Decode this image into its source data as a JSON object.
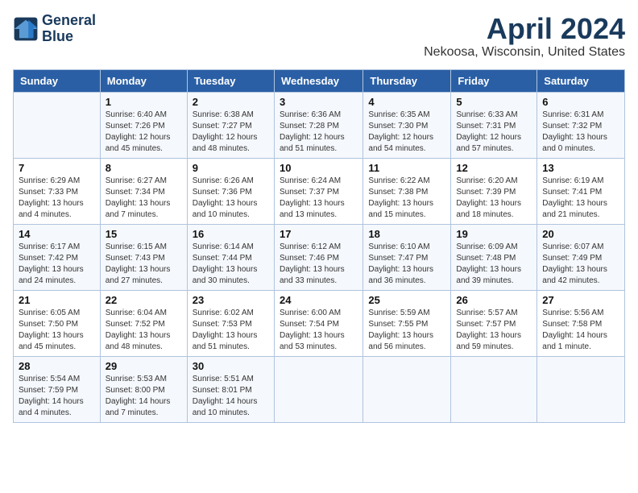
{
  "header": {
    "logo_line1": "General",
    "logo_line2": "Blue",
    "month": "April 2024",
    "location": "Nekoosa, Wisconsin, United States"
  },
  "days_of_week": [
    "Sunday",
    "Monday",
    "Tuesday",
    "Wednesday",
    "Thursday",
    "Friday",
    "Saturday"
  ],
  "weeks": [
    [
      {
        "day": "",
        "info": ""
      },
      {
        "day": "1",
        "info": "Sunrise: 6:40 AM\nSunset: 7:26 PM\nDaylight: 12 hours\nand 45 minutes."
      },
      {
        "day": "2",
        "info": "Sunrise: 6:38 AM\nSunset: 7:27 PM\nDaylight: 12 hours\nand 48 minutes."
      },
      {
        "day": "3",
        "info": "Sunrise: 6:36 AM\nSunset: 7:28 PM\nDaylight: 12 hours\nand 51 minutes."
      },
      {
        "day": "4",
        "info": "Sunrise: 6:35 AM\nSunset: 7:30 PM\nDaylight: 12 hours\nand 54 minutes."
      },
      {
        "day": "5",
        "info": "Sunrise: 6:33 AM\nSunset: 7:31 PM\nDaylight: 12 hours\nand 57 minutes."
      },
      {
        "day": "6",
        "info": "Sunrise: 6:31 AM\nSunset: 7:32 PM\nDaylight: 13 hours\nand 0 minutes."
      }
    ],
    [
      {
        "day": "7",
        "info": "Sunrise: 6:29 AM\nSunset: 7:33 PM\nDaylight: 13 hours\nand 4 minutes."
      },
      {
        "day": "8",
        "info": "Sunrise: 6:27 AM\nSunset: 7:34 PM\nDaylight: 13 hours\nand 7 minutes."
      },
      {
        "day": "9",
        "info": "Sunrise: 6:26 AM\nSunset: 7:36 PM\nDaylight: 13 hours\nand 10 minutes."
      },
      {
        "day": "10",
        "info": "Sunrise: 6:24 AM\nSunset: 7:37 PM\nDaylight: 13 hours\nand 13 minutes."
      },
      {
        "day": "11",
        "info": "Sunrise: 6:22 AM\nSunset: 7:38 PM\nDaylight: 13 hours\nand 15 minutes."
      },
      {
        "day": "12",
        "info": "Sunrise: 6:20 AM\nSunset: 7:39 PM\nDaylight: 13 hours\nand 18 minutes."
      },
      {
        "day": "13",
        "info": "Sunrise: 6:19 AM\nSunset: 7:41 PM\nDaylight: 13 hours\nand 21 minutes."
      }
    ],
    [
      {
        "day": "14",
        "info": "Sunrise: 6:17 AM\nSunset: 7:42 PM\nDaylight: 13 hours\nand 24 minutes."
      },
      {
        "day": "15",
        "info": "Sunrise: 6:15 AM\nSunset: 7:43 PM\nDaylight: 13 hours\nand 27 minutes."
      },
      {
        "day": "16",
        "info": "Sunrise: 6:14 AM\nSunset: 7:44 PM\nDaylight: 13 hours\nand 30 minutes."
      },
      {
        "day": "17",
        "info": "Sunrise: 6:12 AM\nSunset: 7:46 PM\nDaylight: 13 hours\nand 33 minutes."
      },
      {
        "day": "18",
        "info": "Sunrise: 6:10 AM\nSunset: 7:47 PM\nDaylight: 13 hours\nand 36 minutes."
      },
      {
        "day": "19",
        "info": "Sunrise: 6:09 AM\nSunset: 7:48 PM\nDaylight: 13 hours\nand 39 minutes."
      },
      {
        "day": "20",
        "info": "Sunrise: 6:07 AM\nSunset: 7:49 PM\nDaylight: 13 hours\nand 42 minutes."
      }
    ],
    [
      {
        "day": "21",
        "info": "Sunrise: 6:05 AM\nSunset: 7:50 PM\nDaylight: 13 hours\nand 45 minutes."
      },
      {
        "day": "22",
        "info": "Sunrise: 6:04 AM\nSunset: 7:52 PM\nDaylight: 13 hours\nand 48 minutes."
      },
      {
        "day": "23",
        "info": "Sunrise: 6:02 AM\nSunset: 7:53 PM\nDaylight: 13 hours\nand 51 minutes."
      },
      {
        "day": "24",
        "info": "Sunrise: 6:00 AM\nSunset: 7:54 PM\nDaylight: 13 hours\nand 53 minutes."
      },
      {
        "day": "25",
        "info": "Sunrise: 5:59 AM\nSunset: 7:55 PM\nDaylight: 13 hours\nand 56 minutes."
      },
      {
        "day": "26",
        "info": "Sunrise: 5:57 AM\nSunset: 7:57 PM\nDaylight: 13 hours\nand 59 minutes."
      },
      {
        "day": "27",
        "info": "Sunrise: 5:56 AM\nSunset: 7:58 PM\nDaylight: 14 hours\nand 1 minute."
      }
    ],
    [
      {
        "day": "28",
        "info": "Sunrise: 5:54 AM\nSunset: 7:59 PM\nDaylight: 14 hours\nand 4 minutes."
      },
      {
        "day": "29",
        "info": "Sunrise: 5:53 AM\nSunset: 8:00 PM\nDaylight: 14 hours\nand 7 minutes."
      },
      {
        "day": "30",
        "info": "Sunrise: 5:51 AM\nSunset: 8:01 PM\nDaylight: 14 hours\nand 10 minutes."
      },
      {
        "day": "",
        "info": ""
      },
      {
        "day": "",
        "info": ""
      },
      {
        "day": "",
        "info": ""
      },
      {
        "day": "",
        "info": ""
      }
    ]
  ]
}
